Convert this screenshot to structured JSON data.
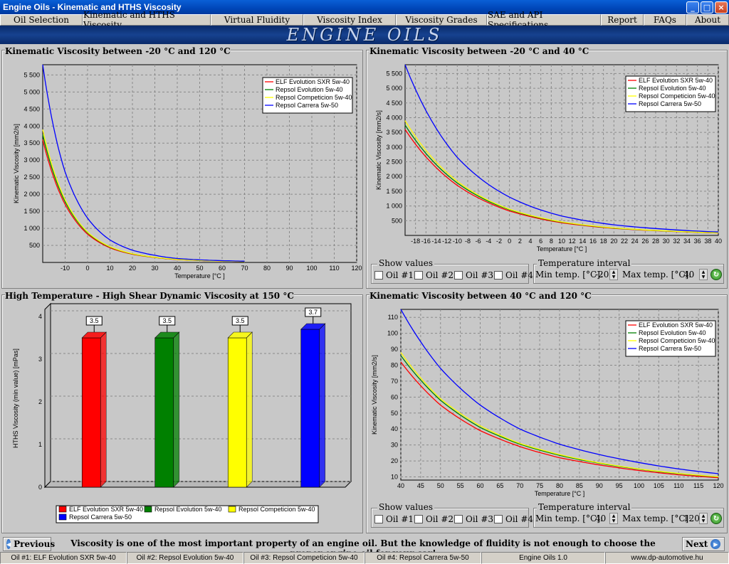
{
  "window": {
    "title": "Engine Oils - Kinematic and HTHS Viscosity",
    "minimize": "_",
    "maximize": "□",
    "close": "×"
  },
  "menu": [
    "Oil Selection",
    "Kinematic and HTHS Viscosity",
    "Virtual Fluidity",
    "Viscosity Index",
    "Viscosity Grades",
    "SAE and API Specifications",
    "Report",
    "FAQs",
    "About"
  ],
  "banner": "ENGINE OILS",
  "oils": [
    {
      "name": "ELF Evolution SXR 5w-40",
      "color": "#ff0000"
    },
    {
      "name": "Repsol Evolution 5w-40",
      "color": "#008000"
    },
    {
      "name": "Repsol Competicion 5w-40",
      "color": "#ffff00"
    },
    {
      "name": "Repsol Carrera 5w-50",
      "color": "#0000ff"
    }
  ],
  "panels": {
    "kv_full": {
      "title": "Kinematic Viscosity between -20 °C and 120 °C"
    },
    "kv_low": {
      "title": "Kinematic Viscosity between -20 °C and 40 °C"
    },
    "hths": {
      "title": "High Temperature - High Shear Dynamic Viscosity at 150 °C"
    },
    "kv_high": {
      "title": "Kinematic Viscosity between 40 °C and 120 °C"
    }
  },
  "chart_data": [
    {
      "type": "line",
      "title": "Kinematic Viscosity between -20 °C and 120 °C",
      "xlabel": "Temperature [°C ]",
      "ylabel": "Kinematic Viscosity [mm2/s]",
      "xlim": [
        -20,
        120
      ],
      "ylim": [
        0,
        5800
      ],
      "xticks": [
        -10,
        0,
        10,
        20,
        30,
        40,
        50,
        60,
        70,
        80,
        90,
        100,
        110,
        120
      ],
      "yticks": [
        500,
        1000,
        1500,
        2000,
        2500,
        3000,
        3500,
        4000,
        4500,
        5000,
        5500
      ],
      "grid": true,
      "legend": "top-right",
      "series": [
        {
          "name": "ELF Evolution SXR 5w-40",
          "x": [
            -20,
            -10,
            0,
            10,
            20,
            30,
            40,
            50,
            60,
            70
          ],
          "y": [
            3600,
            1700,
            830,
            430,
            240,
            145,
            82,
            55,
            38,
            27
          ]
        },
        {
          "name": "Repsol Evolution 5w-40",
          "x": [
            -20,
            -10,
            0,
            10,
            20,
            30,
            40,
            50,
            60,
            70
          ],
          "y": [
            3750,
            1780,
            870,
            450,
            250,
            150,
            86,
            57,
            40,
            28
          ]
        },
        {
          "name": "Repsol Competicion 5w-40",
          "x": [
            -20,
            -10,
            0,
            10,
            20,
            30,
            40,
            50,
            60,
            70
          ],
          "y": [
            3900,
            1840,
            890,
            460,
            255,
            152,
            88,
            58,
            41,
            29
          ]
        },
        {
          "name": "Repsol Carrera 5w-50",
          "x": [
            -20,
            -10,
            0,
            10,
            20,
            30,
            40,
            50,
            60,
            70
          ],
          "y": [
            5800,
            2650,
            1300,
            660,
            360,
            210,
            115,
            76,
            52,
            37
          ]
        }
      ]
    },
    {
      "type": "line",
      "title": "Kinematic Viscosity between -20 °C and 40 °C",
      "xlabel": "Temperature [°C ]",
      "ylabel": "Kinematic Viscosity [mm2/s]",
      "xlim": [
        -20,
        40
      ],
      "ylim": [
        0,
        5800
      ],
      "xticks": [
        -18,
        -16,
        -14,
        -12,
        -10,
        -8,
        -6,
        -4,
        -2,
        0,
        2,
        4,
        6,
        8,
        10,
        12,
        14,
        16,
        18,
        20,
        22,
        24,
        26,
        28,
        30,
        32,
        34,
        36,
        38,
        40
      ],
      "yticks": [
        500,
        1000,
        1500,
        2000,
        2500,
        3000,
        3500,
        4000,
        4500,
        5000,
        5500
      ],
      "grid": true,
      "legend": "top-right",
      "series": [
        {
          "name": "ELF Evolution SXR 5w-40",
          "x": [
            -20,
            -10,
            0,
            10,
            20,
            30,
            40
          ],
          "y": [
            3600,
            1700,
            830,
            430,
            240,
            145,
            82
          ]
        },
        {
          "name": "Repsol Evolution 5w-40",
          "x": [
            -20,
            -10,
            0,
            10,
            20,
            30,
            40
          ],
          "y": [
            3750,
            1780,
            870,
            450,
            250,
            150,
            86
          ]
        },
        {
          "name": "Repsol Competicion 5w-40",
          "x": [
            -20,
            -10,
            0,
            10,
            20,
            30,
            40
          ],
          "y": [
            3900,
            1840,
            890,
            460,
            255,
            152,
            88
          ]
        },
        {
          "name": "Repsol Carrera 5w-50",
          "x": [
            -20,
            -10,
            0,
            10,
            20,
            30,
            40
          ],
          "y": [
            5800,
            2650,
            1300,
            660,
            360,
            210,
            115
          ]
        }
      ]
    },
    {
      "type": "bar",
      "title": "High Temperature - High Shear Dynamic Viscosity at 150 °C",
      "ylabel": "HTHS Viscosity (min value) [mPas]",
      "categories": [
        "ELF Evolution SXR 5w-40",
        "Repsol Evolution 5w-40",
        "Repsol Competicion 5w-40",
        "Repsol Carrera 5w-50"
      ],
      "values": [
        3.5,
        3.5,
        3.5,
        3.7
      ],
      "value_labels": [
        "3.5",
        "3.5",
        "3.5",
        "3.7"
      ],
      "ylim": [
        0,
        4
      ],
      "yticks": [
        0,
        1,
        2,
        3,
        4
      ],
      "grid": true,
      "legend": "bottom"
    },
    {
      "type": "line",
      "title": "Kinematic Viscosity between 40 °C and 120 °C",
      "xlabel": "Temperature [°C ]",
      "ylabel": "Kinematic Viscosity [mm2/s]",
      "xlim": [
        40,
        120
      ],
      "ylim": [
        8,
        115
      ],
      "xticks": [
        40,
        45,
        50,
        55,
        60,
        65,
        70,
        75,
        80,
        85,
        90,
        95,
        100,
        105,
        110,
        115,
        120
      ],
      "yticks": [
        10,
        20,
        30,
        40,
        50,
        60,
        70,
        80,
        90,
        100,
        110
      ],
      "grid": true,
      "legend": "top-right",
      "series": [
        {
          "name": "ELF Evolution SXR 5w-40",
          "x": [
            40,
            50,
            60,
            70,
            80,
            90,
            100,
            110,
            120
          ],
          "y": [
            82,
            55,
            39,
            29,
            22,
            17.5,
            14,
            11.3,
            9.5
          ]
        },
        {
          "name": "Repsol Evolution 5w-40",
          "x": [
            40,
            50,
            60,
            70,
            80,
            90,
            100,
            110,
            120
          ],
          "y": [
            86,
            58,
            41,
            30.5,
            23.5,
            18.5,
            14.8,
            12,
            10
          ]
        },
        {
          "name": "Repsol Competicion 5w-40",
          "x": [
            40,
            50,
            60,
            70,
            80,
            90,
            100,
            110,
            120
          ],
          "y": [
            88,
            59,
            42,
            31,
            24,
            18.8,
            15,
            12.2,
            10.1
          ]
        },
        {
          "name": "Repsol Carrera 5w-50",
          "x": [
            40,
            50,
            60,
            70,
            80,
            90,
            100,
            110,
            120
          ],
          "y": [
            115,
            78,
            55,
            40,
            30.5,
            24,
            19,
            15,
            12
          ]
        }
      ]
    }
  ],
  "controls_low": {
    "show_values": "Show values",
    "oils": [
      "Oil #1",
      "Oil #2",
      "Oil #3",
      "Oil #4"
    ],
    "temp_interval": "Temperature interval",
    "min_label": "Min temp. [°C]:",
    "min_value": "-20",
    "max_label": "Max temp. [°C]:",
    "max_value": "40"
  },
  "controls_high": {
    "show_values": "Show values",
    "oils": [
      "Oil #1",
      "Oil #2",
      "Oil #3",
      "Oil #4"
    ],
    "temp_interval": "Temperature interval",
    "min_label": "Min temp. [°C]:",
    "min_value": "40",
    "max_label": "Max temp. [°C]:",
    "max_value": "120"
  },
  "nav": {
    "previous": "Previous",
    "next": "Next",
    "message": "Viscosity is one of the most important property of an engine oil. But the knowledge of fluidity is not enough to choose the proper engine oil for your car!"
  },
  "status": [
    "Oil #1: ELF Evolution SXR 5w-40",
    "Oil #2: Repsol Evolution 5w-40",
    "Oil #3: Repsol Competicion 5w-40",
    "Oil #4: Repsol Carrera 5w-50",
    "Engine Oils 1.0",
    "www.dp-automotive.hu"
  ]
}
